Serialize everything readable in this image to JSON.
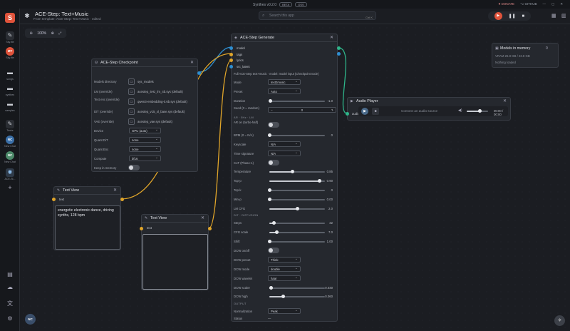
{
  "topbar": {
    "app_name": "Synthes v0.2.0",
    "badge_beta": "BETA",
    "badge_extra": "OSS",
    "donate": "♥ DONATE",
    "github": "⌥ GITHUB",
    "min": "—",
    "max": "▢",
    "close": "✕"
  },
  "sidebar": {
    "logo": "S",
    "items": [
      {
        "label": "Sky.lite",
        "icon": "✎"
      },
      {
        "label": "Sky.lite",
        "icon": "MT"
      },
      {
        "label": "songs",
        "icon": "▬"
      },
      {
        "label": "synthes",
        "icon": "▬"
      },
      {
        "label": "samples",
        "icon": "▬"
      },
      {
        "label": "Tasks",
        "icon": "✎"
      },
      {
        "label": "New Chat",
        "icon": "NC"
      },
      {
        "label": "New Chat",
        "icon": "NC"
      },
      {
        "label": "ACE-St...",
        "icon": "✱"
      }
    ],
    "add": "+",
    "bottom_avatar": "NC"
  },
  "header": {
    "title": "ACE-Step: Text+Music",
    "subtitle": "From template: ACE-Step: Text+Music · edited",
    "search_placeholder": "Search this app",
    "search_kbd": "Ctrl K"
  },
  "zoom": {
    "level": "100%"
  },
  "checkpoint_node": {
    "title": "ACE-Step Checkpoint",
    "rows": [
      {
        "label": "Models directory",
        "value": "sys_models"
      },
      {
        "label": "LM (override)",
        "value": "acestep_5Hz_lm_4b.sys (default)"
      },
      {
        "label": "Text enc (override)",
        "value": "qwen3-embedding-0.6b.sys (default)"
      },
      {
        "label": "DiT (override)",
        "value": "acestep_v15_xl_base.sys (default)"
      },
      {
        "label": "VAE (override)",
        "value": "acestep_vae.sys (default)"
      }
    ],
    "device_label": "Device",
    "device_value": "GPU (auto)",
    "quant_dit_label": "Quant DiT",
    "quant_dit_value": "none",
    "quant_enc_label": "Quant Enc",
    "quant_enc_value": "none",
    "compute_label": "Compute",
    "compute_value": "bf16",
    "keep_label": "Keep in memory"
  },
  "textview1": {
    "title": "Text View",
    "port": "text",
    "content": "energetic electronic dance, driving synths, 128 bpm"
  },
  "textview2": {
    "title": "Text View",
    "port": "text",
    "content": ""
  },
  "generate_node": {
    "title": "ACE-Step Generate",
    "inputs": [
      "model",
      "tags",
      "lyrics",
      "src_latent"
    ],
    "description": "Full ACE-Step text+music · model: model input (Checkpoint node)",
    "mode_label": "Mode",
    "mode_value": "text2music",
    "preset_label": "Preset",
    "preset_value": "Auto",
    "duration_label": "Duration",
    "duration_value": "-1.0",
    "duration_frac": 0.02,
    "seed_label": "Seed (0 = random)",
    "seed_value": "0",
    "seed_minus": "−",
    "seed_plus": "+",
    "ar_label": "AR · 5Hz · LM",
    "ar_toggle_label": "AR on (turbo-half)",
    "bpm_label": "BPM (0 = N/A)",
    "bpm_value": "0",
    "bpm_frac": 0.0,
    "keyscale_label": "Keyscale",
    "keyscale_value": "N/A",
    "timesig_label": "Time signature",
    "timesig_value": "N/A",
    "cot_label": "CoT (Phase-1)",
    "sliders": [
      {
        "label": "Temperature",
        "value": "0.85",
        "frac": 0.42
      },
      {
        "label": "Top-p",
        "value": "0.90",
        "frac": 0.9
      },
      {
        "label": "Top-k",
        "value": "0",
        "frac": 0.0
      },
      {
        "label": "Min-p",
        "value": "0.00",
        "frac": 0.0
      },
      {
        "label": "LM CFG",
        "value": "2.0",
        "frac": 0.5
      }
    ],
    "dit_section": "DIT · DIFFUSION",
    "dit_sliders": [
      {
        "label": "Steps",
        "value": "32",
        "frac": 0.08
      },
      {
        "label": "CFG scale",
        "value": "7.0",
        "frac": 0.14
      },
      {
        "label": "Shift",
        "value": "1.00",
        "frac": 0.0
      }
    ],
    "dcw_onoff_label": "DCW on/off",
    "dcw_preset_label": "DCW preset",
    "dcw_preset_value": "Think",
    "dcw_mode_label": "DCW mode",
    "dcw_mode_value": "double",
    "dcw_wavelet_label": "DCW wavelet",
    "dcw_wavelet_value": "haar",
    "dcw_scaler_label": "DCW scaler",
    "dcw_scaler_value": "0.030",
    "dcw_scaler_frac": 0.03,
    "dcw_high_label": "DCW high",
    "dcw_high_value": "0.060",
    "dcw_high_frac": 0.25,
    "output_section": "OUTPUT",
    "norm_label": "Normalization",
    "norm_value": "Peak",
    "status_label": "Status",
    "status_value": "—"
  },
  "audio_node": {
    "title": "Audio Player",
    "port": "audio",
    "placeholder": "Connect an audio source",
    "time": "00:00 / 00:00",
    "volume_frac": 0.6
  },
  "memory_panel": {
    "title": "Models in memory",
    "count": "0",
    "vram": "VRAM 26.8 GB / 23.8 GB",
    "status": "Nothing loaded"
  },
  "colors": {
    "accent": "#e0533b",
    "model_wire": "#2f8fd1",
    "text_wire": "#e0a52a",
    "audio_wire": "#2fb58a"
  }
}
